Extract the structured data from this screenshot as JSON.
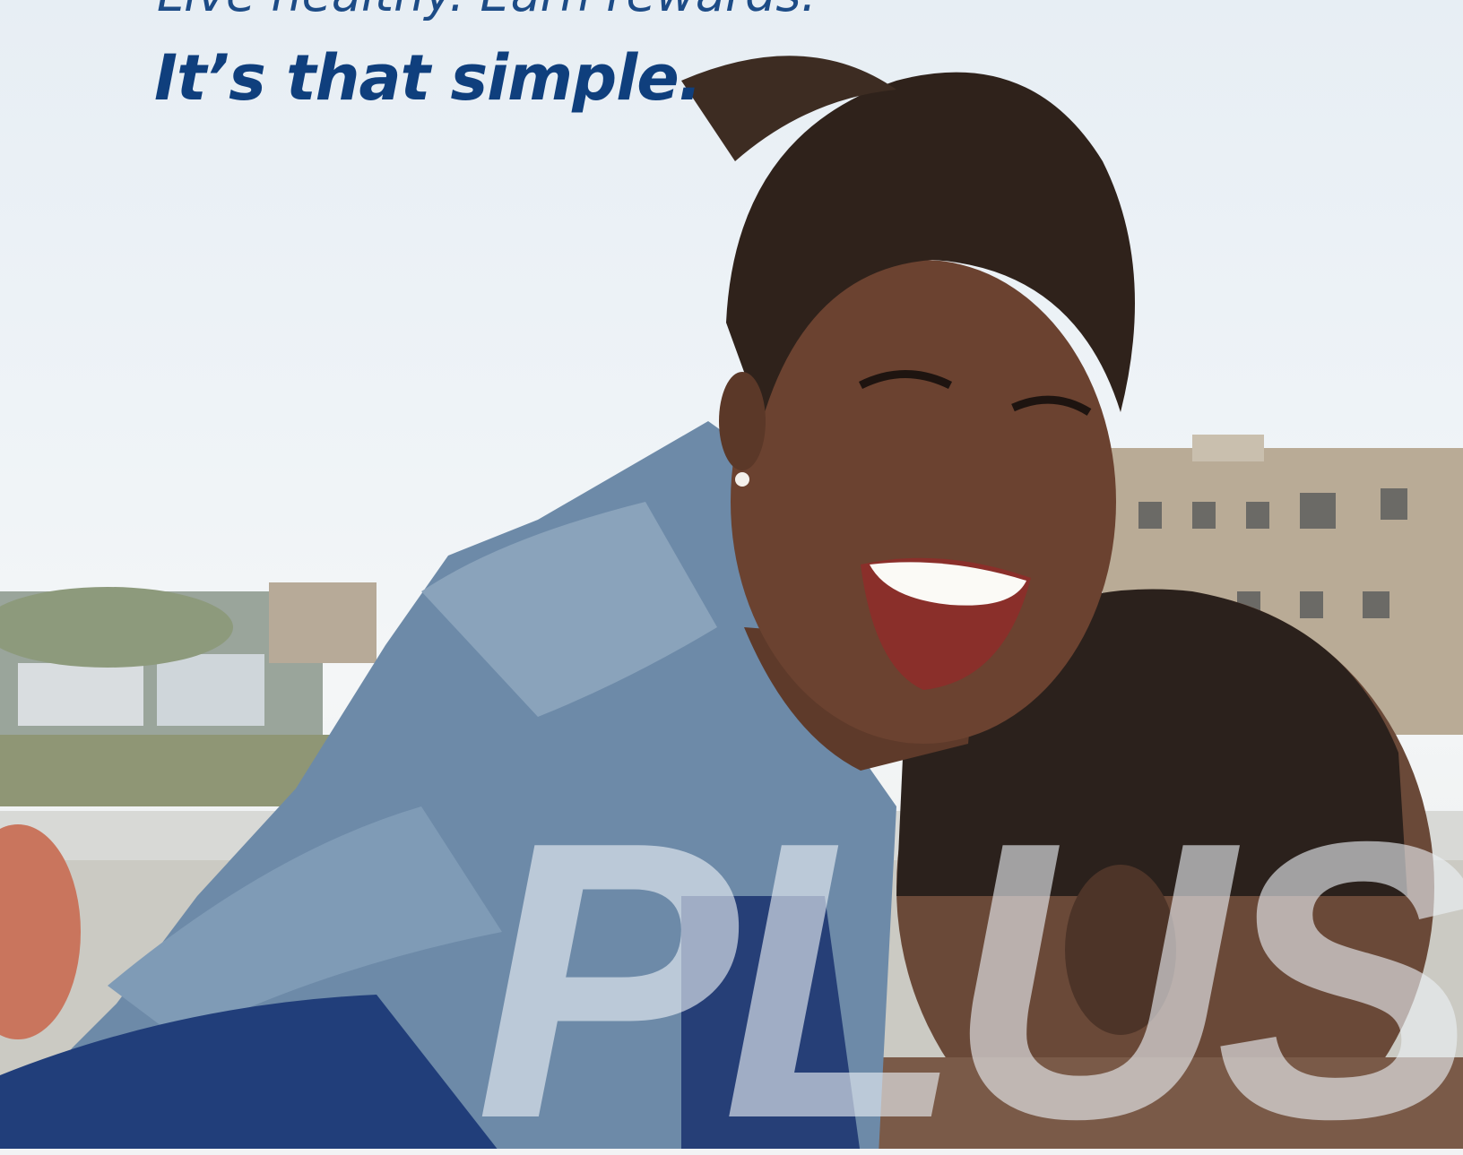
{
  "hero": {
    "tagline": "Live healthy. Earn rewards.",
    "headline": "It’s that simple.",
    "watermark": "PLUS"
  },
  "colors": {
    "headline": "#0f3f7d",
    "tagline": "#1c4b86",
    "sky": "#e7eef4"
  }
}
